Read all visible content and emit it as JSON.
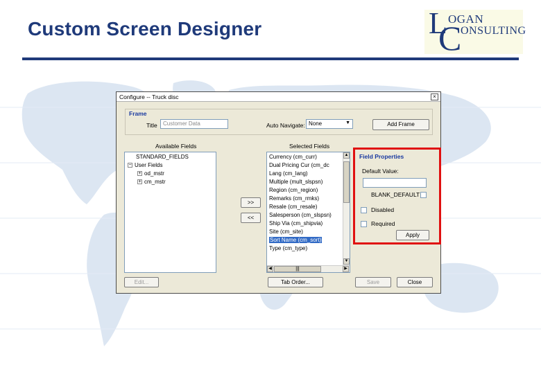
{
  "slide": {
    "title": "Custom Screen Designer",
    "accent_color": "#1f3a7a",
    "highlight_color": "#e01010"
  },
  "logo": {
    "letter_l": "L",
    "letter_c": "C",
    "word1": "OGAN",
    "word2": "ONSULTING"
  },
  "dialog": {
    "title": "Configure -- Truck disc",
    "close_icon": "close-icon",
    "frame": {
      "label": "Frame",
      "title_label": "Title",
      "title_value": "Customer Data",
      "auto_navigate_label": "Auto Navigate:",
      "auto_navigate_value": "None",
      "add_frame_button": "Add Frame"
    },
    "available_fields": {
      "label": "Available Fields",
      "items": [
        {
          "text": "STANDARD_FIELDS",
          "indent": 0,
          "toggle": ""
        },
        {
          "text": "User Fields",
          "indent": 0,
          "toggle": "−"
        },
        {
          "text": "od_mstr",
          "indent": 1,
          "toggle": "+"
        },
        {
          "text": "cm_mstr",
          "indent": 1,
          "toggle": "+"
        }
      ]
    },
    "move_right_button": ">>",
    "move_left_button": "<<",
    "selected_fields": {
      "label": "Selected Fields",
      "items": [
        "Currency (cm_curr)",
        "Dual Pricing Cur (cm_dc",
        "Lang (cm_lang)",
        "Multiple (mult_slspsn)",
        "Region (cm_region)",
        "Remarks (cm_rmks)",
        "Resale (cm_resale)",
        "Salesperson (cm_slspsn)",
        "Ship Via (cm_shipvia)",
        "Site (cm_site)",
        "Sort Name (cm_sort)",
        "Type (cm_type)"
      ],
      "selected_index": 10
    },
    "field_properties": {
      "label": "Field Properties",
      "default_value_label": "Default Value:",
      "default_value": "",
      "blank_default_label": "BLANK_DEFAULT",
      "disabled_label": "Disabled",
      "required_label": "Required",
      "apply_button": "Apply"
    },
    "edit_button": "Edit...",
    "tab_order_button": "Tab Order...",
    "save_button": "Save",
    "close_button": "Close"
  }
}
